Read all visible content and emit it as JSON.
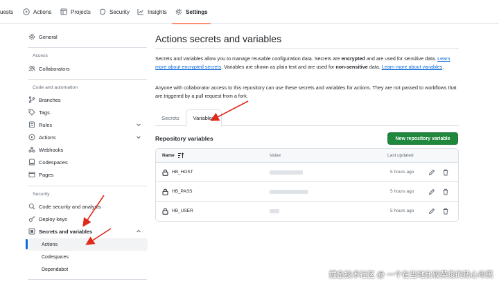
{
  "topnav": {
    "tabs": [
      {
        "label": "uests",
        "icon": "pull-request-icon"
      },
      {
        "label": "Actions",
        "icon": "play-icon"
      },
      {
        "label": "Projects",
        "icon": "table-icon"
      },
      {
        "label": "Security",
        "icon": "shield-icon"
      },
      {
        "label": "Insights",
        "icon": "graph-icon"
      },
      {
        "label": "Settings",
        "icon": "gear-icon",
        "active": true
      }
    ]
  },
  "sidebar": {
    "general": "General",
    "access_heading": "Access",
    "collaborators": "Collaborators",
    "code_heading": "Code and automation",
    "branches": "Branches",
    "tags": "Tags",
    "rules": "Rules",
    "actions": "Actions",
    "webhooks": "Webhooks",
    "codespaces": "Codespaces",
    "pages": "Pages",
    "security_heading": "Security",
    "code_security": "Code security and analysis",
    "deploy_keys": "Deploy keys",
    "secrets_variables": "Secrets and variables",
    "sub_actions": "Actions",
    "sub_codespaces": "Codespaces",
    "sub_dependabot": "Dependabot"
  },
  "main": {
    "title": "Actions secrets and variables",
    "desc1_a": "Secrets and variables allow you to manage reusable configuration data. Secrets are ",
    "desc1_b": "encrypted",
    "desc1_c": " and are used for sensitive data. ",
    "desc1_link1": "Learn more about encrypted secrets",
    "desc1_d": ". Variables are shown as plain text and are used for ",
    "desc1_e": "non-sensitive",
    "desc1_f": " data. ",
    "desc1_link2": "Learn more about variables",
    "desc1_g": ".",
    "desc2": "Anyone with collaborator access to this repository can use these secrets and variables for actions. They are not passed to workflows that are triggered by a pull request from a fork.",
    "tab_secrets": "Secrets",
    "tab_variables": "Variables",
    "repo_heading": "Repository variables",
    "new_button": "New repository variable",
    "table": {
      "col_name": "Name",
      "col_value": "Value",
      "col_updated": "Last updated",
      "rows": [
        {
          "name": "HB_HOST",
          "updated": "5 hours ago"
        },
        {
          "name": "HB_PASS",
          "updated": "5 hours ago"
        },
        {
          "name": "HB_USER",
          "updated": "5 hours ago"
        }
      ]
    }
  },
  "watermark": "掘金技术社区 @ 一个在当地比较英俊的热心市民",
  "colors": {
    "accent": "#0969da",
    "primary_button": "#1f883d",
    "active_tab_underline": "#fd8c73",
    "annotation_arrow": "#e02a1c"
  }
}
